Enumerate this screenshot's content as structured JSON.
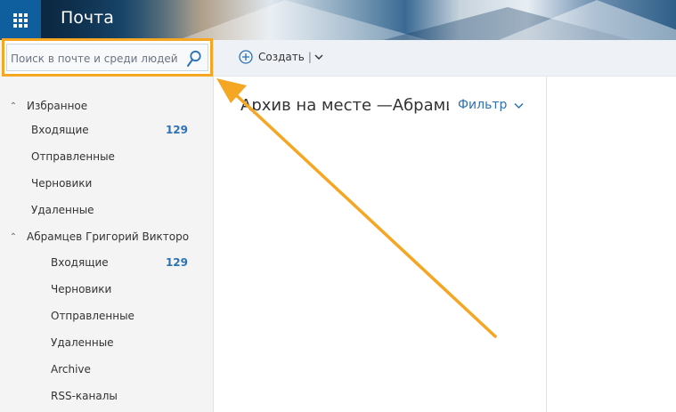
{
  "header": {
    "app_title": "Почта",
    "icon": "waffle-icon"
  },
  "search": {
    "placeholder": "Поиск в почте и среди людей",
    "icon": "search-icon"
  },
  "commandbar": {
    "create_label": "Создать",
    "create_icon": "plus-circle-icon",
    "separator": "|",
    "dropdown_icon": "chevron-down-icon"
  },
  "favorites": {
    "label": "Избранное",
    "items": [
      {
        "label": "Входящие",
        "count": "129"
      },
      {
        "label": "Отправленные",
        "count": ""
      },
      {
        "label": "Черновики",
        "count": ""
      },
      {
        "label": "Удаленные",
        "count": ""
      }
    ]
  },
  "account": {
    "label": "Абрамцев Григорий Викторо",
    "items": [
      {
        "label": "Входящие",
        "count": "129"
      },
      {
        "label": "Черновики",
        "count": ""
      },
      {
        "label": "Отправленные",
        "count": ""
      },
      {
        "label": "Удаленные",
        "count": ""
      },
      {
        "label": "Archive",
        "count": ""
      },
      {
        "label": "RSS-каналы",
        "count": ""
      }
    ]
  },
  "messagelist": {
    "folder_title": "Архив на месте —Абрамцев Григорий Викторович",
    "filter_label": "Фильтр"
  },
  "colors": {
    "accent": "#2c72b5",
    "highlight": "#f5a623",
    "waffle_bg": "#0f5f9e"
  }
}
